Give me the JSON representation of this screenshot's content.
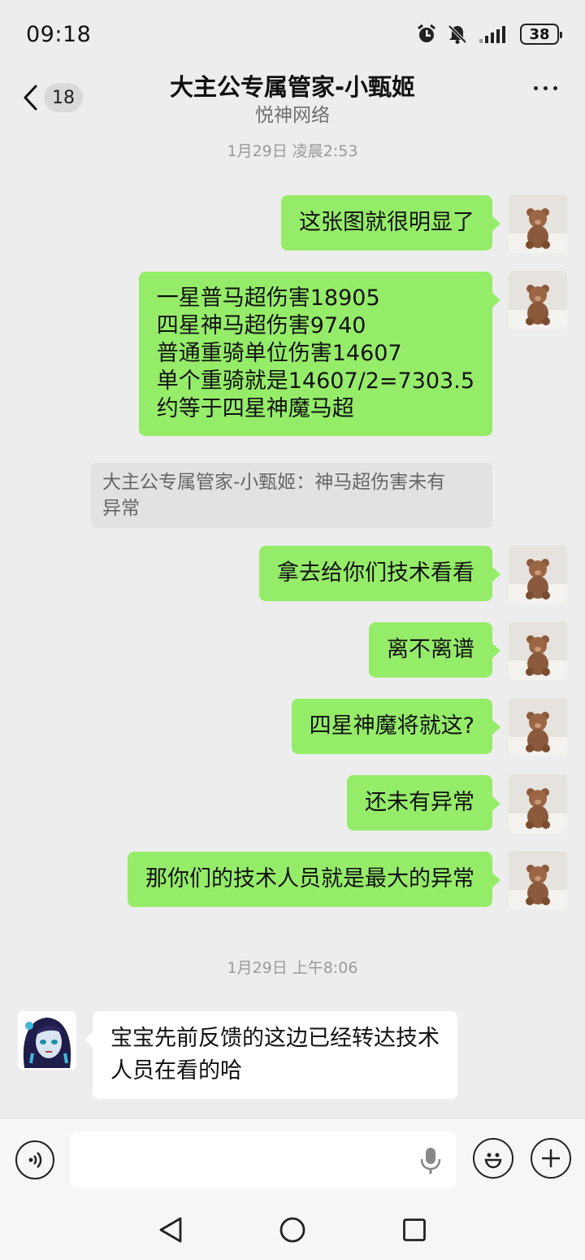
{
  "status_bar": {
    "time": "09:18",
    "battery": "38",
    "icons": [
      "alarm-icon",
      "mute-icon",
      "signal-icon"
    ]
  },
  "header": {
    "unread_count": "18",
    "title": "大主公专属管家-小甄姬",
    "subtitle": "悦神网络",
    "icons": [
      "back-icon",
      "more-icon"
    ]
  },
  "timestamps": [
    "1月29日 凌晨2:53",
    "1月29日 上午8:06"
  ],
  "messages": [
    {
      "side": "right",
      "lines": [
        "这张图就很明显了"
      ]
    },
    {
      "side": "right",
      "lines": [
        "一星普马超伤害18905",
        "四星神马超伤害9740",
        "普通重骑单位伤害14607",
        "单个重骑就是14607/2=7303.5",
        "约等于四星神魔马超"
      ]
    },
    {
      "side": "right",
      "lines": [
        "拿去给你们技术看看"
      ]
    },
    {
      "side": "right",
      "lines": [
        "离不离谱"
      ]
    },
    {
      "side": "right",
      "lines": [
        "四星神魔将就这?"
      ]
    },
    {
      "side": "right",
      "lines": [
        "还未有异常"
      ]
    },
    {
      "side": "right",
      "lines": [
        "那你们的技术人员就是最大的异常"
      ]
    },
    {
      "side": "left",
      "lines": [
        "宝宝先前反馈的这边已经转达技术",
        "人员在看的哈"
      ]
    }
  ],
  "quote": {
    "lines": [
      "大主公专属管家-小甄姬：神马超伤害未有",
      "异常"
    ]
  },
  "input": {
    "value": "",
    "icons": [
      "voice-icon",
      "mic-icon",
      "emoji-icon",
      "plus-icon"
    ]
  },
  "nav": {
    "icons": [
      "back-triangle-icon",
      "home-circle-icon",
      "recents-square-icon"
    ]
  },
  "colors": {
    "background": "#ededed",
    "own_bubble": "#95ec69",
    "other_bubble": "#ffffff",
    "quote_bg": "#e2e2e2"
  }
}
